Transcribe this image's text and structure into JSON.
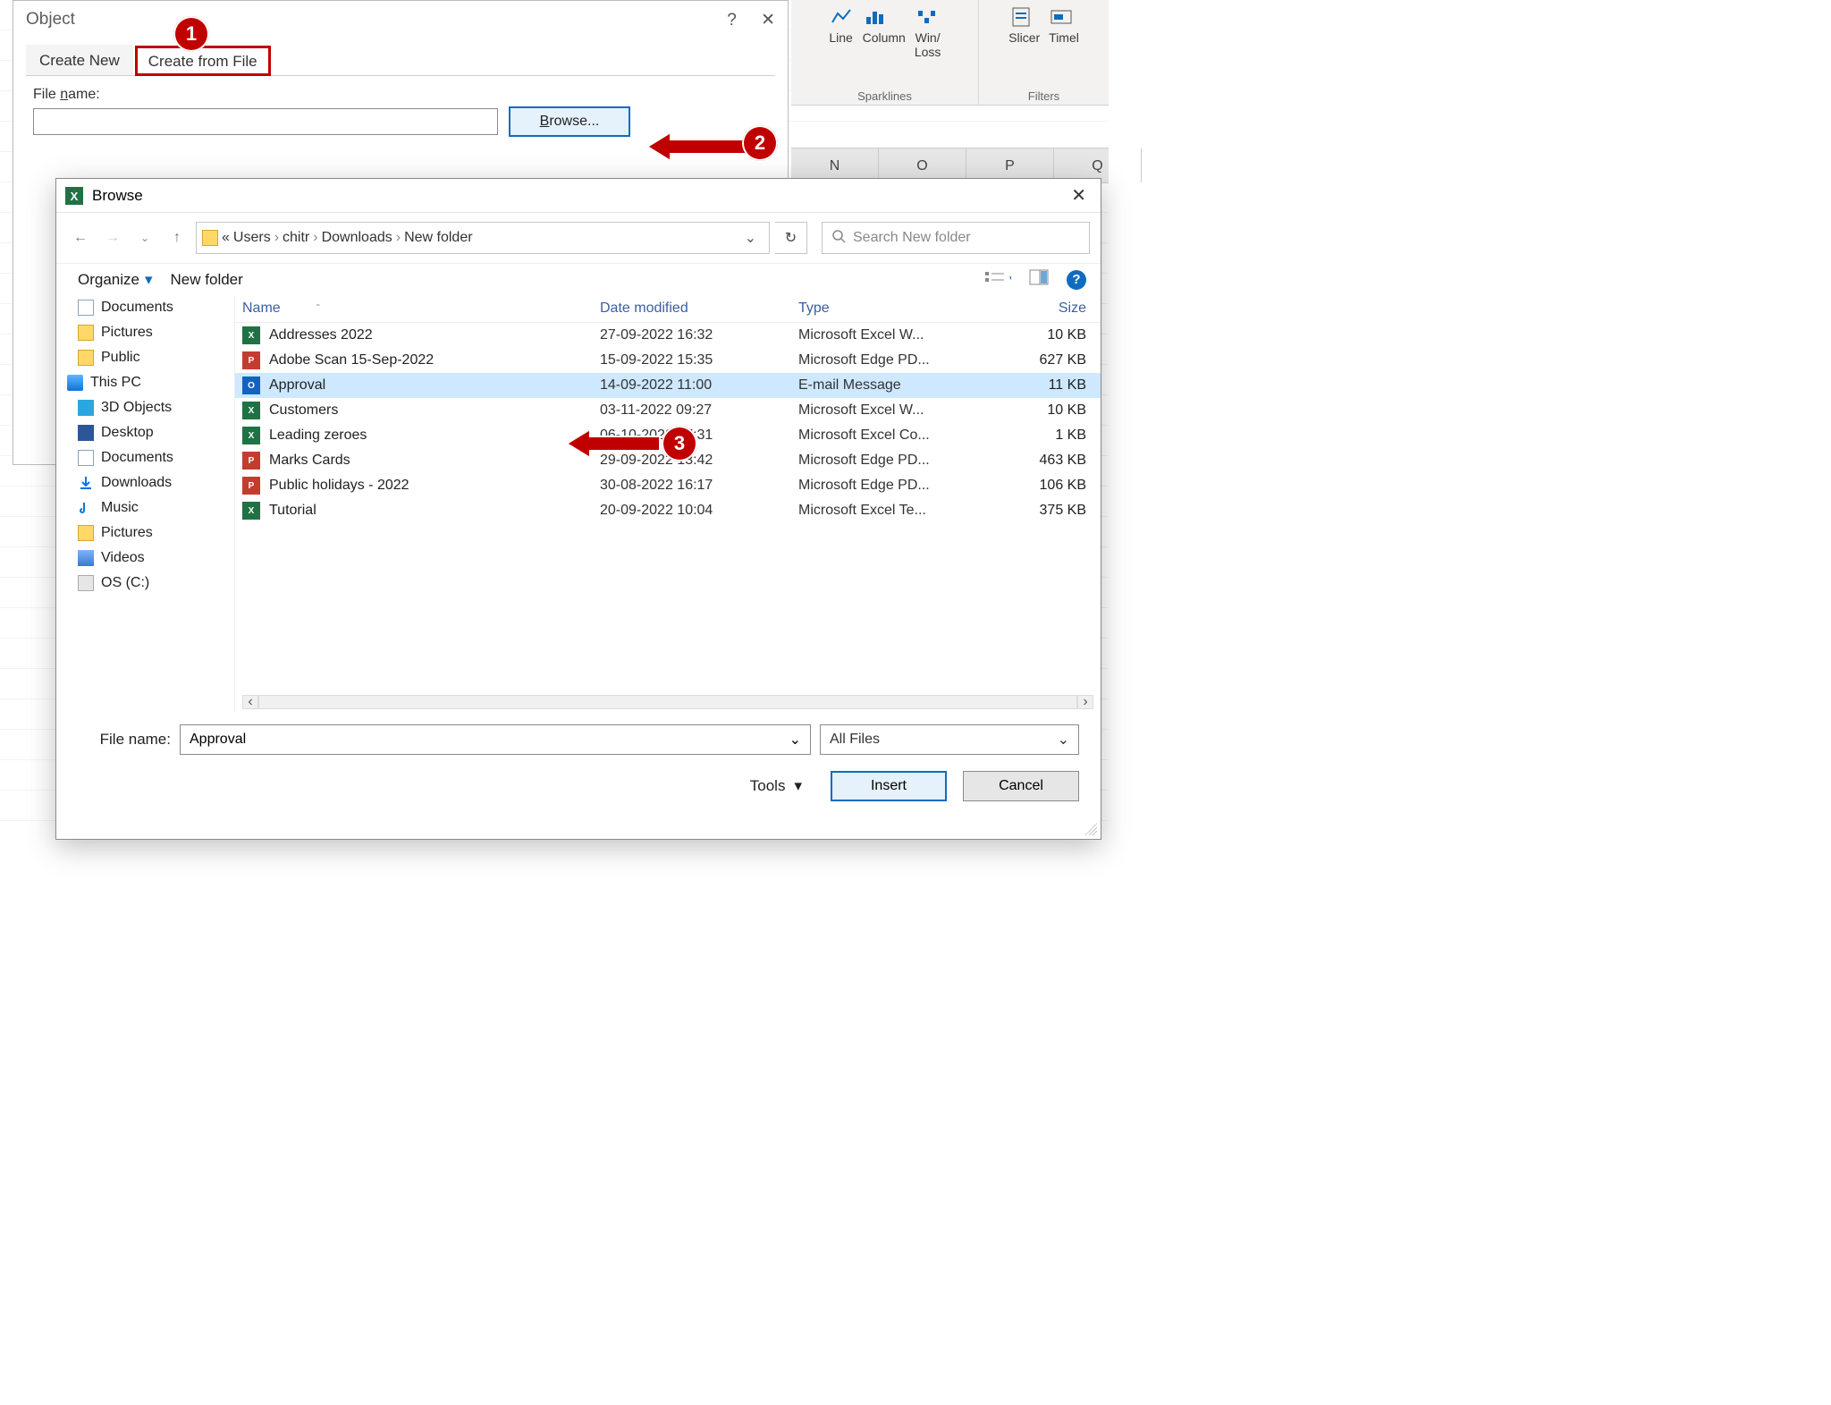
{
  "ribbon": {
    "sparklines": {
      "items": [
        {
          "label": "Line"
        },
        {
          "label": "Column"
        },
        {
          "label": "Win/\nLoss"
        }
      ],
      "group_label": "Sparklines"
    },
    "filters": {
      "items": [
        {
          "label": "Slicer"
        },
        {
          "label": "Timel"
        }
      ],
      "group_label": "Filters"
    }
  },
  "column_headers": [
    "N",
    "O",
    "P",
    "Q"
  ],
  "object_dialog": {
    "title": "Object",
    "tab1": "Create New",
    "tab2": "Create from File",
    "file_name_label": "File name:",
    "browse_label": "Browse..."
  },
  "callouts": {
    "c1": "1",
    "c2": "2",
    "c3": "3"
  },
  "browse": {
    "title": "Browse",
    "crumbs": [
      "Users",
      "chitr",
      "Downloads",
      "New folder"
    ],
    "crumb_prefix": "«",
    "search_placeholder": "Search New folder",
    "organize": "Organize",
    "new_folder": "New folder",
    "tree": [
      {
        "label": "Documents",
        "icon": "doc",
        "lvl": 1
      },
      {
        "label": "Pictures",
        "icon": "folder",
        "lvl": 1
      },
      {
        "label": "Public",
        "icon": "folder",
        "lvl": 1
      },
      {
        "label": "This PC",
        "icon": "pc",
        "lvl": 0
      },
      {
        "label": "3D Objects",
        "icon": "blue",
        "lvl": 1
      },
      {
        "label": "Desktop",
        "icon": "mon",
        "lvl": 1
      },
      {
        "label": "Documents",
        "icon": "doc",
        "lvl": 1
      },
      {
        "label": "Downloads",
        "icon": "down",
        "lvl": 1
      },
      {
        "label": "Music",
        "icon": "music",
        "lvl": 1
      },
      {
        "label": "Pictures",
        "icon": "folder",
        "lvl": 1
      },
      {
        "label": "Videos",
        "icon": "vid",
        "lvl": 1
      },
      {
        "label": "OS (C:)",
        "icon": "drive",
        "lvl": 1
      }
    ],
    "columns": {
      "name": "Name",
      "date": "Date modified",
      "type": "Type",
      "size": "Size"
    },
    "files": [
      {
        "icon": "xls",
        "name": "Addresses 2022",
        "date": "27-09-2022 16:32",
        "type": "Microsoft Excel W...",
        "size": "10 KB"
      },
      {
        "icon": "pdf",
        "name": "Adobe Scan 15-Sep-2022",
        "date": "15-09-2022 15:35",
        "type": "Microsoft Edge PD...",
        "size": "627 KB"
      },
      {
        "icon": "msg",
        "name": "Approval",
        "date": "14-09-2022 11:00",
        "type": "E-mail Message",
        "size": "11 KB",
        "selected": true
      },
      {
        "icon": "xls",
        "name": "Customers",
        "date": "03-11-2022 09:27",
        "type": "Microsoft Excel W...",
        "size": "10 KB"
      },
      {
        "icon": "xls",
        "name": "Leading zeroes",
        "date": "06-10-2022 07:31",
        "type": "Microsoft Excel Co...",
        "size": "1 KB"
      },
      {
        "icon": "pdf",
        "name": "Marks Cards",
        "date": "29-09-2022 13:42",
        "type": "Microsoft Edge PD...",
        "size": "463 KB"
      },
      {
        "icon": "pdf",
        "name": "Public holidays - 2022",
        "date": "30-08-2022 16:17",
        "type": "Microsoft Edge PD...",
        "size": "106 KB"
      },
      {
        "icon": "xls",
        "name": "Tutorial",
        "date": "20-09-2022 10:04",
        "type": "Microsoft Excel Te...",
        "size": "375 KB"
      }
    ],
    "file_name_label": "File name:",
    "file_name_value": "Approval",
    "type_filter": "All Files",
    "tools": "Tools",
    "insert": "Insert",
    "cancel": "Cancel"
  }
}
